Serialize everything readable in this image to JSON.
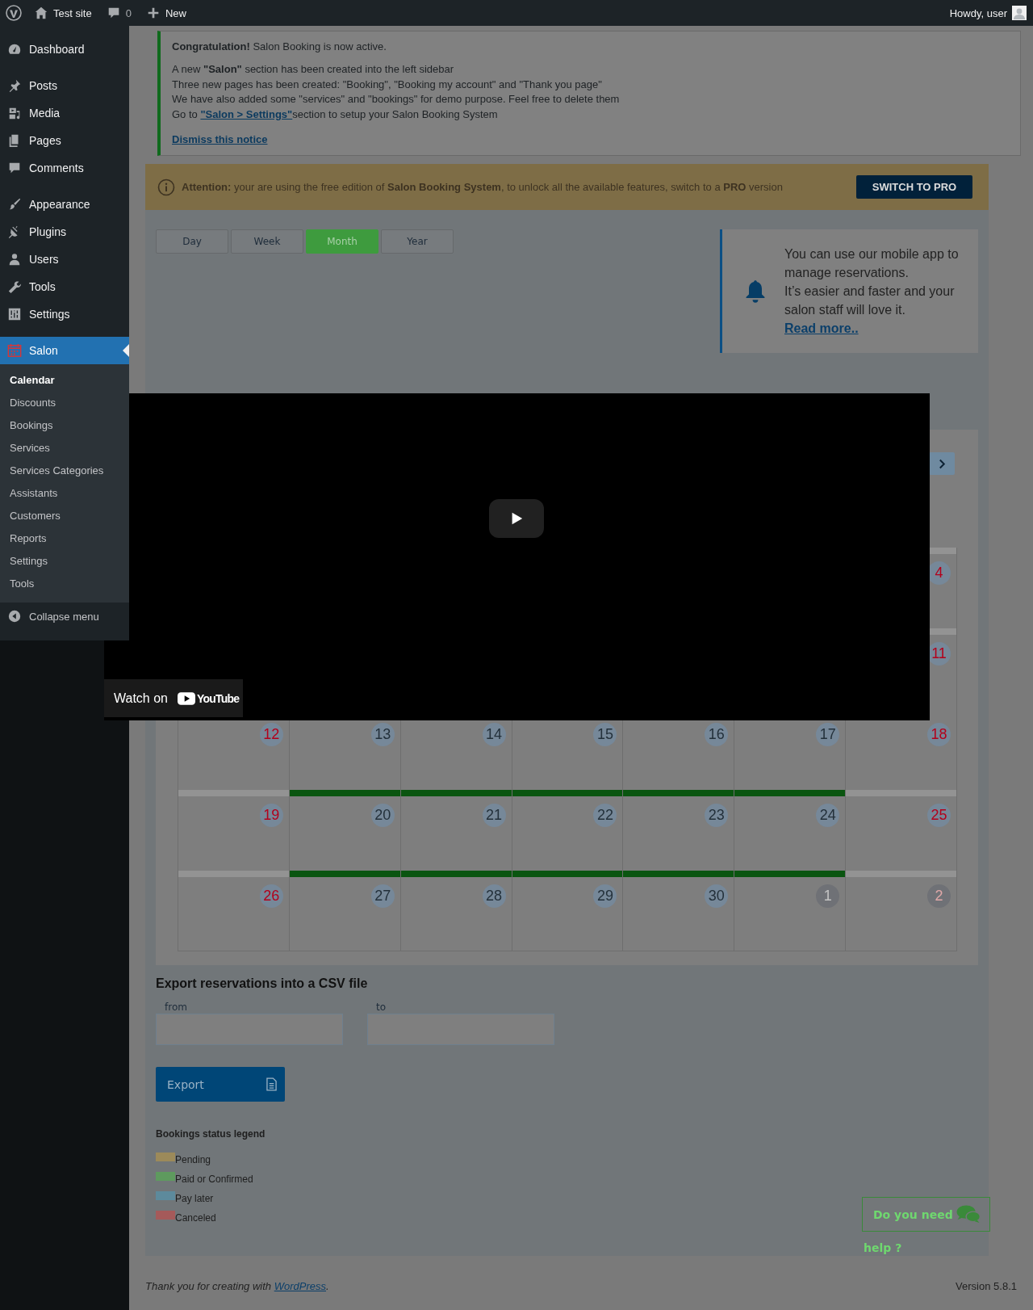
{
  "admin_bar": {
    "site": "Test site",
    "comments": "0",
    "new": "New",
    "greeting": "Howdy, user"
  },
  "sidebar": {
    "groups": [
      [
        {
          "label": "Dashboard",
          "selected": false
        }
      ],
      [
        {
          "label": "Posts",
          "selected": false
        },
        {
          "label": "Media",
          "selected": false
        },
        {
          "label": "Pages",
          "selected": false
        },
        {
          "label": "Comments",
          "selected": false
        }
      ],
      [
        {
          "label": "Appearance",
          "selected": false
        },
        {
          "label": "Plugins",
          "selected": false
        },
        {
          "label": "Users",
          "selected": false
        },
        {
          "label": "Tools",
          "selected": false
        },
        {
          "label": "Settings",
          "selected": false
        }
      ],
      [
        {
          "label": "Salon",
          "selected": true,
          "children": [
            {
              "label": "Calendar",
              "selected": true
            },
            {
              "label": "Discounts",
              "selected": false
            },
            {
              "label": "Bookings",
              "selected": false
            },
            {
              "label": "Services",
              "selected": false
            },
            {
              "label": "Services Categories",
              "selected": false
            },
            {
              "label": "Assistants",
              "selected": false
            },
            {
              "label": "Customers",
              "selected": false
            },
            {
              "label": "Reports",
              "selected": false
            },
            {
              "label": "Settings",
              "selected": false
            },
            {
              "label": "Tools",
              "selected": false
            }
          ]
        }
      ]
    ],
    "collapse": "Collapse menu"
  },
  "notice": {
    "title": "**Congratulation!** Salon Booking is now active.",
    "lines": [
      "A new **\"Salon\"** section has been created into the left sidebar",
      "Three new pages has been created: \"Booking\", \"Booking my account\" and \"Thank you page\"",
      "We have also added some \"services\" and \"bookings\" for demo purpose. Feel free to delete them"
    ],
    "settings_line": {
      "before": "Go to ",
      "link": "\"Salon > Settings\"",
      "after": "section to setup your Salon Booking System"
    },
    "dismiss": "Dismiss this notice"
  },
  "attention": {
    "text": "**Attention:** your are using the free edition of **Salon Booking System**, to unlock all the available features, switch to a **PRO** version",
    "button": "SWITCH TO PRO"
  },
  "view_tabs": [
    {
      "label": "Day",
      "selected": false
    },
    {
      "label": "Week",
      "selected": false
    },
    {
      "label": "Month",
      "selected": true
    },
    {
      "label": "Year",
      "selected": false
    }
  ],
  "app_promo": {
    "lines": [
      "You can use our mobile app to manage reservations.",
      "It’s easier and faster and your salon staff will love it."
    ],
    "link": "Read more.."
  },
  "video": {
    "watch_label": "Watch on",
    "brand": "YouTube"
  },
  "calendar": {
    "weeks": [
      {
        "cells": [
          {
            "day": "4",
            "kind": "weekend",
            "open": false
          }
        ]
      },
      {
        "cells": [
          {
            "day": "11",
            "kind": "weekend",
            "open": false
          }
        ]
      },
      {
        "cells": [
          {
            "day": "12",
            "kind": "weekend"
          },
          {
            "day": "13",
            "kind": "weekday"
          },
          {
            "day": "14",
            "kind": "weekday"
          },
          {
            "day": "15",
            "kind": "weekday"
          },
          {
            "day": "16",
            "kind": "weekday"
          },
          {
            "day": "17",
            "kind": "weekday"
          },
          {
            "day": "18",
            "kind": "weekend"
          }
        ]
      },
      {
        "cells": [
          {
            "day": "19",
            "kind": "weekend",
            "open": false
          },
          {
            "day": "20",
            "kind": "weekday",
            "open": true
          },
          {
            "day": "21",
            "kind": "weekday",
            "open": true
          },
          {
            "day": "22",
            "kind": "weekday",
            "open": true
          },
          {
            "day": "23",
            "kind": "weekday",
            "open": true
          },
          {
            "day": "24",
            "kind": "weekday",
            "open": true
          },
          {
            "day": "25",
            "kind": "weekend",
            "open": false
          }
        ]
      },
      {
        "cells": [
          {
            "day": "26",
            "kind": "weekend",
            "open": false
          },
          {
            "day": "27",
            "kind": "weekday",
            "open": true
          },
          {
            "day": "28",
            "kind": "weekday",
            "open": true
          },
          {
            "day": "29",
            "kind": "weekday",
            "open": true
          },
          {
            "day": "30",
            "kind": "weekday",
            "open": true
          },
          {
            "day": "1",
            "kind": "other",
            "open": true
          },
          {
            "day": "2",
            "kind": "other_weekend",
            "open": false
          }
        ]
      }
    ]
  },
  "export": {
    "title": "Export reservations into a CSV file",
    "from_label": "from",
    "to_label": "to",
    "button": "Export"
  },
  "legend": {
    "title": "Bookings status legend",
    "items": [
      {
        "label": "Pending",
        "color": "#9c8a5a"
      },
      {
        "label": "Paid or Confirmed",
        "color": "#5e9a5e"
      },
      {
        "label": "Pay later",
        "color": "#5d8a9c"
      },
      {
        "label": "Canceled",
        "color": "#a55a5a"
      }
    ]
  },
  "help": {
    "lines": [
      "Do you need",
      "help ?"
    ]
  },
  "footer": {
    "before": "Thank you for creating with ",
    "link": "WordPress",
    "after": ".",
    "version": "Version 5.8.1"
  }
}
